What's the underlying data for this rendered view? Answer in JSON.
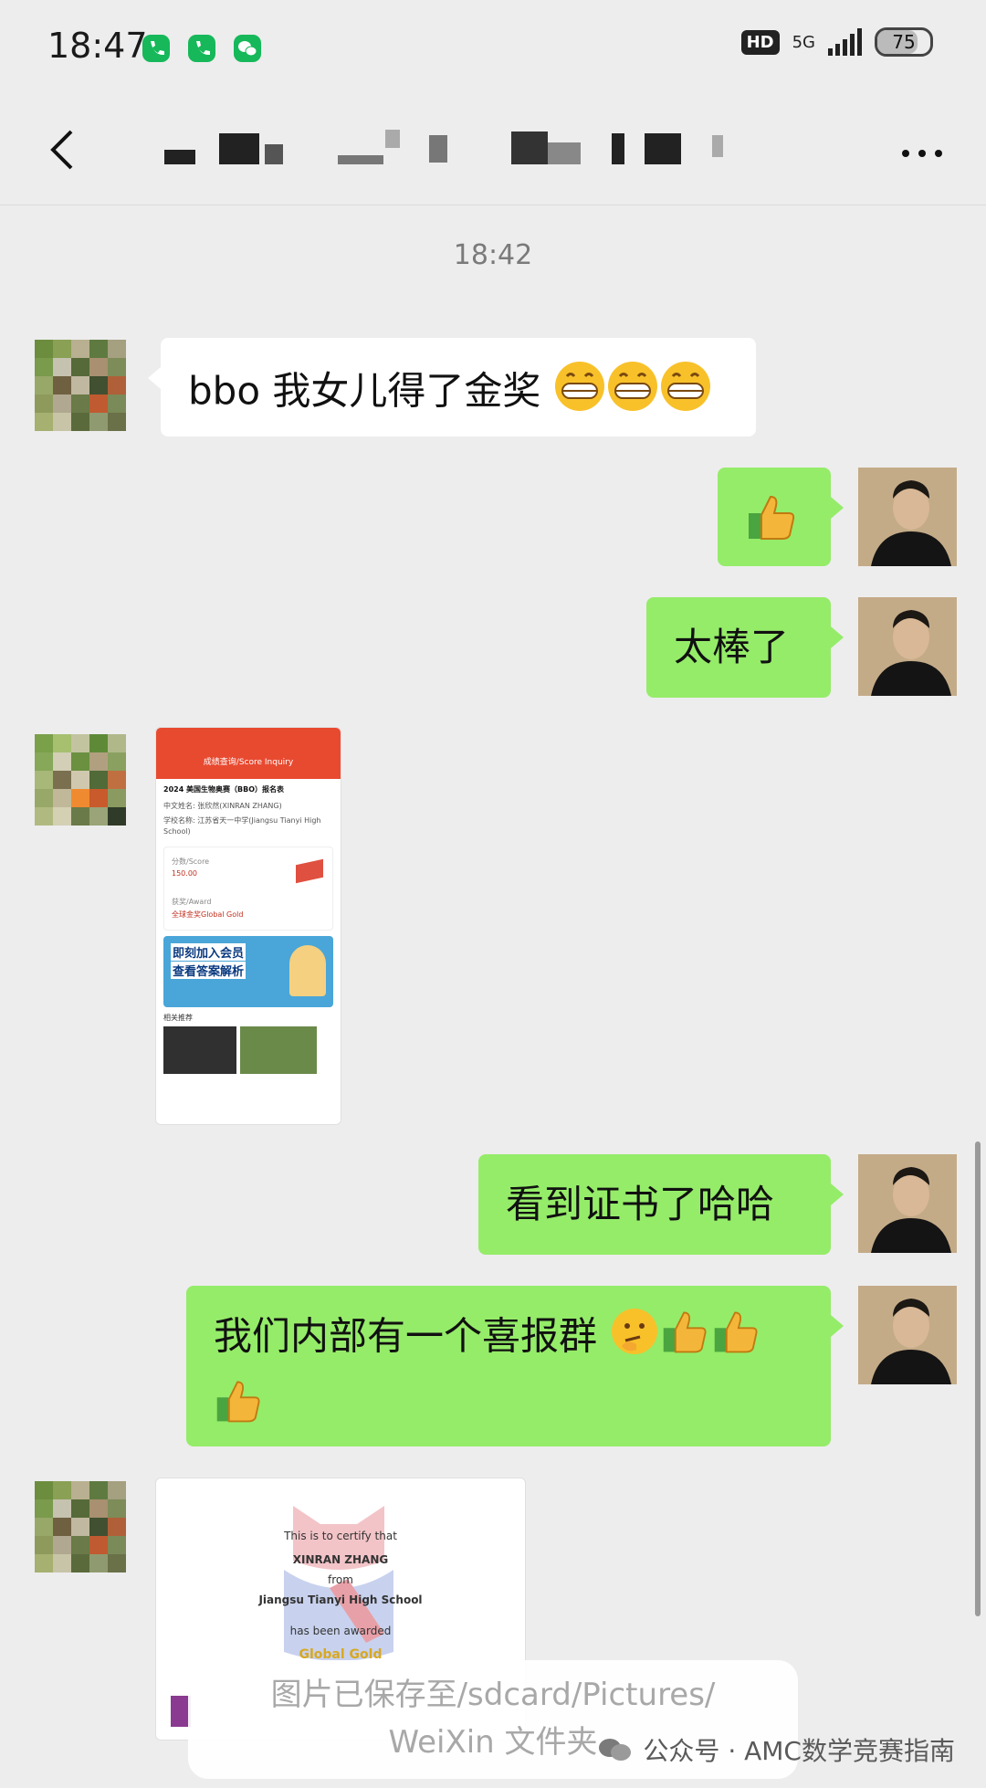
{
  "status_bar": {
    "time": "18:47",
    "network": "5G",
    "hd": "HD",
    "battery": "75",
    "battery_level": 0.75
  },
  "header": {
    "back_icon": "chevron-left-icon",
    "more_icon": "more-dots-icon"
  },
  "chat": {
    "timestamp": "18:42",
    "messages": [
      {
        "side": "left",
        "type": "text",
        "text": "bbo 我女儿得了金奖",
        "emoji": "grinning-face-icon x3"
      },
      {
        "side": "right",
        "type": "emoji",
        "emoji": "thumbs-up-icon"
      },
      {
        "side": "right",
        "type": "text",
        "text": "太棒了"
      },
      {
        "side": "left",
        "type": "image",
        "description": "score-inquiry-screenshot",
        "content": {
          "topbar": "成绩查询/Score Inquiry",
          "title": "2024 美国生物奥赛（BBO）报名表",
          "name_row": "中文姓名: 张欣然(XINRAN ZHANG)",
          "school_row": "学校名称: 江苏省天一中学(Jiangsu Tianyi High School)",
          "score_label": "分数/Score",
          "score_value": "150.00",
          "award_label": "获奖/Award",
          "award_value": "全球金奖Global Gold",
          "banner_line1": "即刻加入会员",
          "banner_line2": "查看答案解析",
          "section": "相关推荐"
        }
      },
      {
        "side": "right",
        "type": "text",
        "text": "看到证书了哈哈"
      },
      {
        "side": "right",
        "type": "text",
        "text": "我们内部有一个喜报群",
        "emoji": "thinking-face thumbs-up x3"
      },
      {
        "side": "left",
        "type": "image",
        "description": "certificate-image",
        "content": {
          "line1": "This is to certify that",
          "name": "XINRAN ZHANG",
          "line3": "from",
          "school": "Jiangsu Tianyi High School",
          "line5": "has been awarded",
          "award": "Global Gold"
        }
      }
    ]
  },
  "toast": {
    "line1": "图片已保存至/sdcard/Pictures/",
    "line2": "WeiXin 文件夹"
  },
  "watermark": {
    "text": "公众号 · AMC数学竞赛指南"
  },
  "colors": {
    "background": "#ededed",
    "bubble_right": "#95ec69",
    "bubble_left": "#ffffff",
    "header_bg": "#ededed"
  }
}
